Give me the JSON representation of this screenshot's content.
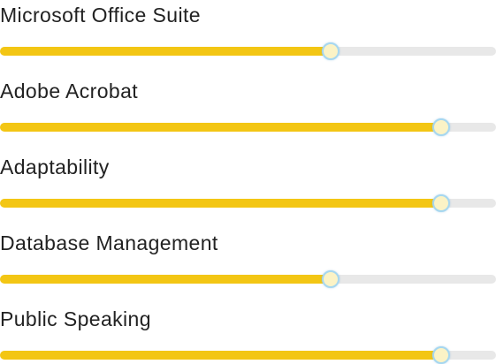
{
  "skills": [
    {
      "label": "Microsoft Office Suite",
      "level": 66.6
    },
    {
      "label": "Adobe Acrobat",
      "level": 89
    },
    {
      "label": "Adaptability",
      "level": 89
    },
    {
      "label": "Database Management",
      "level": 66.6
    },
    {
      "label": "Public Speaking",
      "level": 89
    }
  ],
  "colors": {
    "fill": "#f3c614",
    "track": "#e8e8e8",
    "handle_border": "#a6d7f0",
    "handle_fill": "#fbf3c6",
    "label": "#222222"
  }
}
